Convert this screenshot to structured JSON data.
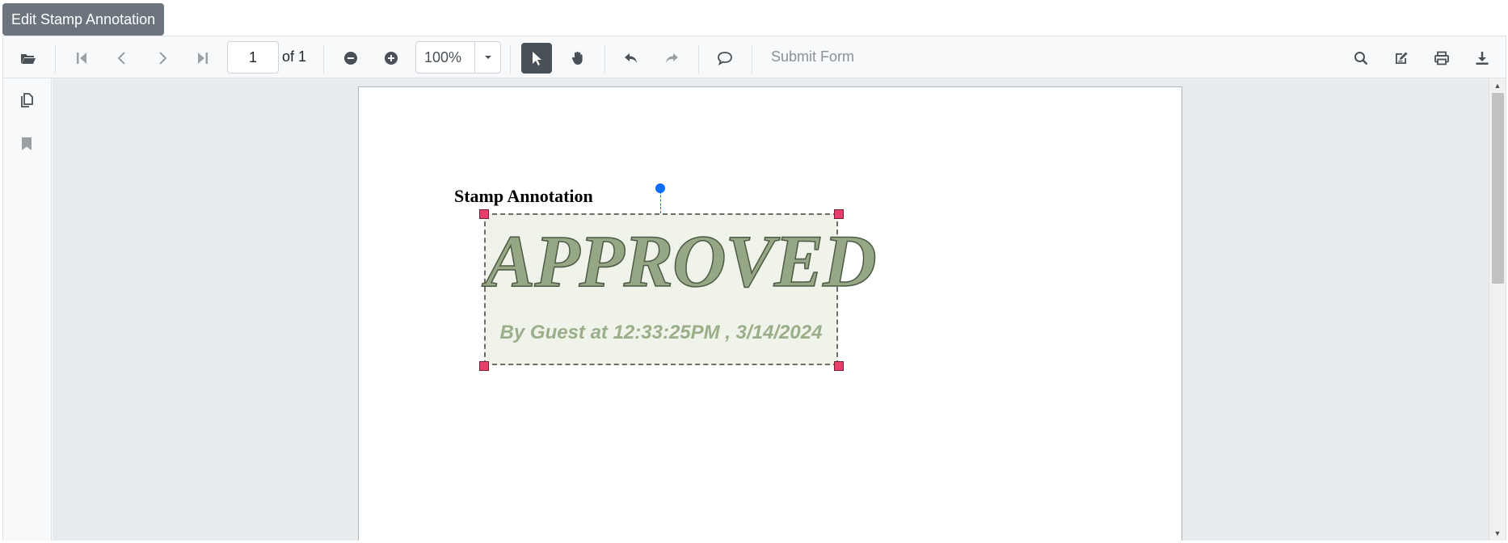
{
  "edit_button": {
    "label": "Edit Stamp Annotation"
  },
  "toolbar": {
    "open_icon": "folder-open-icon",
    "first_page_icon": "first-page-icon",
    "prev_page_icon": "previous-page-icon",
    "next_page_icon": "next-page-icon",
    "last_page_icon": "last-page-icon",
    "page_number": "1",
    "page_total_label": "of 1",
    "zoom_out_icon": "zoom-out-icon",
    "zoom_in_icon": "zoom-in-icon",
    "zoom_value": "100%",
    "select_tool_icon": "pointer-icon",
    "pan_tool_icon": "hand-icon",
    "undo_icon": "undo-icon",
    "redo_icon": "redo-icon",
    "comment_icon": "comment-icon",
    "submit_form_label": "Submit Form",
    "search_icon": "search-icon",
    "annotation_edit_icon": "edit-annotation-icon",
    "print_icon": "print-icon",
    "download_icon": "download-icon"
  },
  "sidebar": {
    "thumbnails_icon": "page-thumbnails-icon",
    "bookmarks_icon": "bookmark-icon"
  },
  "document": {
    "heading": "Stamp Annotation",
    "stamp": {
      "main_text": "APPROVED",
      "sub_text": "By Guest at 12:33:25PM , 3/14/2024",
      "fill_color": "#f0f3ea",
      "text_color": "#96a786"
    }
  },
  "colors": {
    "accent": "#0d6efd",
    "handle": "#e83e6c",
    "active_tool_bg": "#495057",
    "edit_button_bg": "#6c757d"
  }
}
